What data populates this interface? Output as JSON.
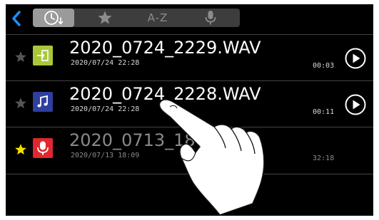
{
  "topbar": {
    "back_icon": "chevron-left-icon",
    "tabs": [
      {
        "icon": "clock-sort-icon",
        "active": true
      },
      {
        "icon": "star-icon",
        "active": false
      },
      {
        "label": "A-Z",
        "active": false
      },
      {
        "icon": "microphone-icon",
        "active": false
      }
    ]
  },
  "files": [
    {
      "name": "2020_0724_2229.WAV",
      "date": "2020/07/24 22:28",
      "duration": "00:03",
      "favorite": false,
      "type_icon": "import-icon",
      "icon_color": "#a8c83a",
      "play": true
    },
    {
      "name": "2020_0724_2228.WAV",
      "date": "2020/07/24 22:28",
      "duration": "00:11",
      "favorite": false,
      "type_icon": "music-note-icon",
      "icon_color": "#2f3f9e",
      "play": true
    },
    {
      "name": "2020_0713_18",
      "date": "2020/07/13 18:09",
      "duration": "32:18",
      "favorite": true,
      "type_icon": "microphone-icon",
      "icon_color": "#e0262e",
      "play": false
    }
  ],
  "colors": {
    "accent": "#1e90ff",
    "favorite_star": "#f5e000",
    "background": "#000000"
  }
}
